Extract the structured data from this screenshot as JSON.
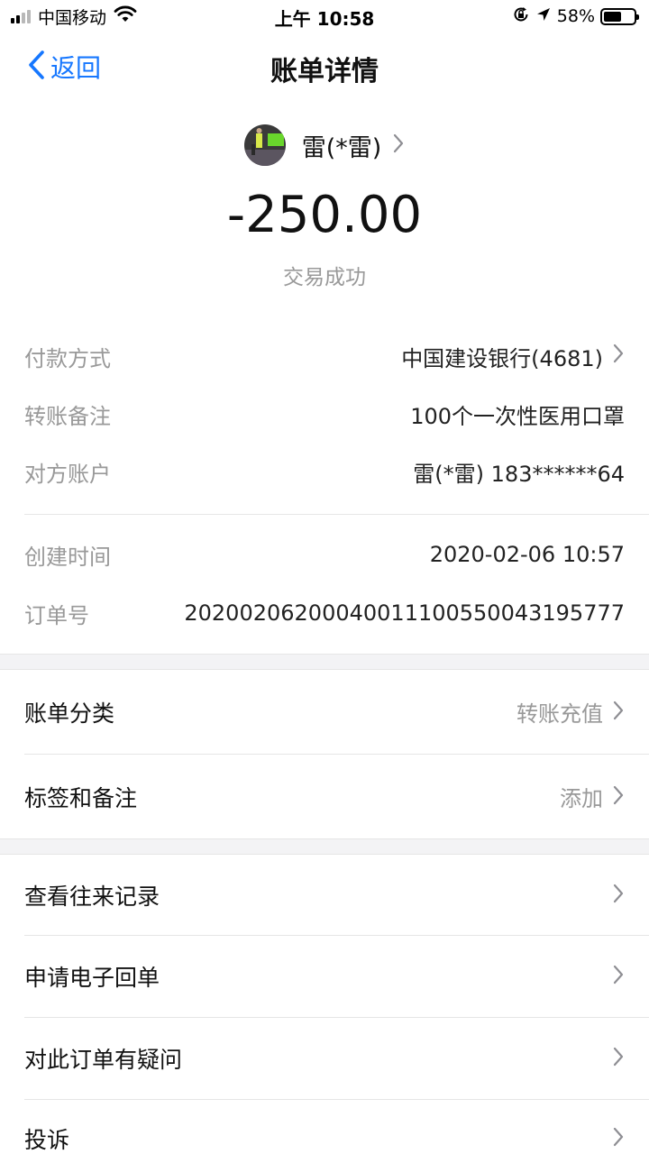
{
  "status_bar": {
    "carrier": "中国移动",
    "time": "上午 10:58",
    "battery": "58%",
    "battery_level": 0.58,
    "icons": [
      "signal-icon",
      "wifi-icon",
      "rotation-lock-icon",
      "location-icon",
      "battery-icon"
    ]
  },
  "nav": {
    "back_label": "返回",
    "title": "账单详情"
  },
  "header": {
    "payee": "雷(*雷)",
    "amount": "-250.00",
    "status": "交易成功"
  },
  "details": [
    {
      "label": "付款方式",
      "value": "中国建设银行(4681)",
      "chevron": true
    },
    {
      "label": "转账备注",
      "value": "100个一次性医用口罩",
      "chevron": false
    },
    {
      "label": "对方账户",
      "value": "雷(*雷) 183******64",
      "chevron": false
    },
    {
      "label": "创建时间",
      "value": "2020-02-06 10:57",
      "chevron": false
    },
    {
      "label": "订单号",
      "value": "20200206200040011100550043195777",
      "chevron": false
    }
  ],
  "group1": [
    {
      "label": "账单分类",
      "value": "转账充值"
    },
    {
      "label": "标签和备注",
      "value": "添加"
    }
  ],
  "group2": [
    {
      "label": "查看往来记录"
    },
    {
      "label": "申请电子回单"
    },
    {
      "label": "对此订单有疑问"
    },
    {
      "label": "投诉"
    }
  ],
  "colors": {
    "accent": "#1677ff",
    "secondary_text": "#999999",
    "background_band": "#f3f3f5"
  }
}
